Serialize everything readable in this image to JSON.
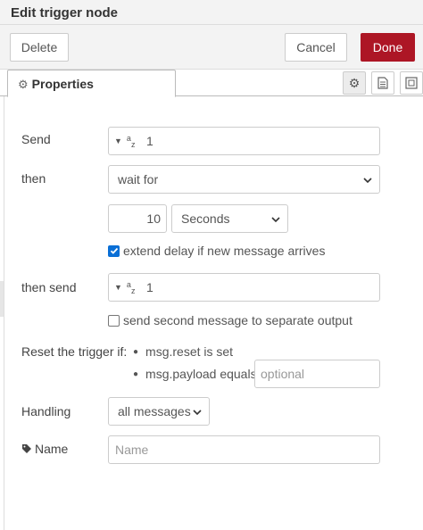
{
  "header": {
    "title": "Edit trigger node"
  },
  "toolbar": {
    "delete_label": "Delete",
    "cancel_label": "Cancel",
    "done_label": "Done"
  },
  "tabs": {
    "properties_label": "Properties"
  },
  "form": {
    "send": {
      "label": "Send",
      "type_indicator": "a z",
      "value": "1"
    },
    "then": {
      "label": "then",
      "selected": "wait for"
    },
    "wait": {
      "amount": "10",
      "units_selected": "Seconds"
    },
    "extend_delay": {
      "label": "extend delay if new message arrives",
      "checked": true
    },
    "then_send": {
      "label": "then send",
      "value": "1"
    },
    "second_output": {
      "label": "send second message to separate output",
      "checked": false
    },
    "reset": {
      "label": "Reset the trigger if:",
      "condition_1": "msg.reset is set",
      "condition_2": "msg.payload equals",
      "payload_placeholder": "optional"
    },
    "handling": {
      "label": "Handling",
      "selected": "all messages"
    },
    "name": {
      "label": "Name",
      "placeholder": "Name"
    }
  },
  "colors": {
    "done_button": "#ad1625",
    "checkbox_checked": "#0a6fd6"
  }
}
